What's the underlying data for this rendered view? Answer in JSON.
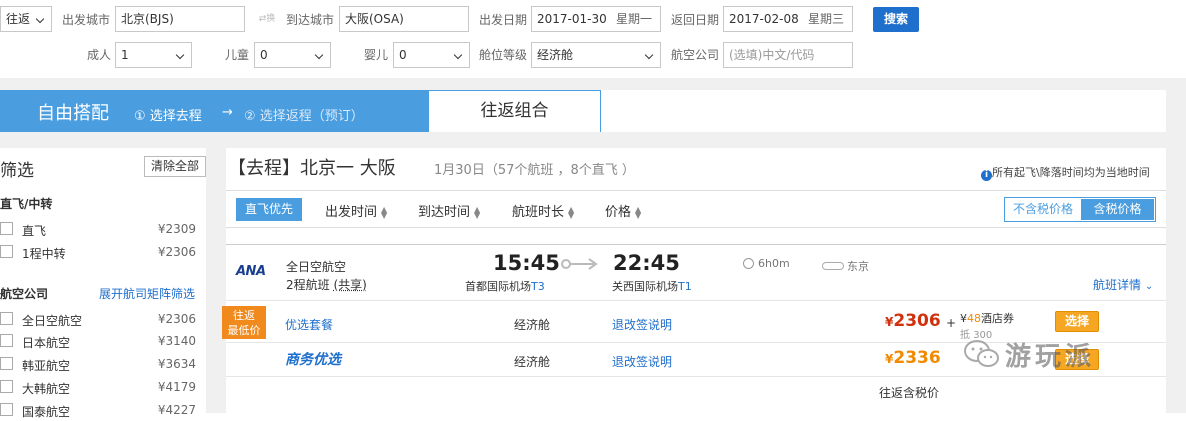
{
  "search": {
    "trip_type": "往返",
    "from_label": "出发城市",
    "from_value": "北京(BJS)",
    "swap_label": "换",
    "to_label": "到达城市",
    "to_value": "大阪(OSA)",
    "depart_label": "出发日期",
    "depart_date": "2017-01-30",
    "depart_weekday": "星期一",
    "return_label": "返回日期",
    "return_date": "2017-02-08",
    "return_weekday": "星期三",
    "search_button": "搜索",
    "adult_label": "成人",
    "adult_value": "1",
    "child_label": "儿童",
    "child_value": "0",
    "infant_label": "婴儿",
    "infant_value": "0",
    "cabin_label": "舱位等级",
    "cabin_value": "经济舱",
    "airline_label": "航空公司",
    "airline_placeholder": "(选填)中文/代码"
  },
  "tabs": {
    "title": "自由搭配",
    "step1": "① 选择去程",
    "arrow": "→",
    "step2": "② 选择返程（预订）",
    "combo": "往返组合"
  },
  "sidebar": {
    "title": "筛选",
    "clear_all": "清除全部",
    "direct_section": "直飞/中转",
    "direct_items": [
      {
        "name": "直飞",
        "price": "¥2309"
      },
      {
        "name": "1程中转",
        "price": "¥2306"
      }
    ],
    "airline_section": "航空公司",
    "airline_matrix_link": "展开航司矩阵筛选",
    "airline_items": [
      {
        "name": "全日空航空",
        "price": "¥2306"
      },
      {
        "name": "日本航空",
        "price": "¥3140"
      },
      {
        "name": "韩亚航空",
        "price": "¥3634"
      },
      {
        "name": "大韩航空",
        "price": "¥4179"
      },
      {
        "name": "国泰航空",
        "price": "¥4227"
      }
    ]
  },
  "results": {
    "leg_tag": "【去程】",
    "route": "北京一 大阪",
    "summary": "1月30日（57个航班 ，8个直飞 ）",
    "time_note": "所有起飞\\降落时间均为当地时间",
    "sort": {
      "direct_first": "直飞优先",
      "depart_time": "出发时间",
      "arrive_time": "到达时间",
      "duration": "航班时长",
      "price": "价格"
    },
    "price_toggle": {
      "excl_tax": "不含税价格",
      "incl_tax": "含税价格"
    },
    "flight": {
      "airline_logo": "ANA",
      "airline_name": "全日空航空",
      "leg_info": "2程航班",
      "codeshare": "(共享)",
      "depart_time": "15:45",
      "depart_airport": "首都国际机场",
      "depart_terminal": "T3",
      "arrive_time": "22:45",
      "arrive_airport": "关西国际机场",
      "arrive_terminal": "T1",
      "duration": "6h0m",
      "stopover": "东京",
      "details_link": "航班详情"
    },
    "fares": [
      {
        "badge_line1": "往返",
        "badge_line2": "最低价",
        "package": "优选套餐",
        "cabin": "经济舱",
        "rules": "退改签说明",
        "currency": "¥",
        "price": "2306",
        "plus": "+",
        "voucher_value": "48",
        "voucher_label": "酒店券",
        "deduct_text": "抵",
        "deduct_value": "300",
        "select": "选择"
      },
      {
        "package": "商务优选",
        "cabin": "经济舱",
        "rules": "退改签说明",
        "currency": "¥",
        "price": "2336",
        "select": "选择"
      }
    ],
    "footer_note": "往返含税价"
  },
  "watermark": "游玩派",
  "colors": {
    "brand_blue": "#4a9ee0",
    "button_blue": "#1f6fcc",
    "price_red": "#e03a10",
    "price_orange": "#f08a00",
    "select_orange": "#f5a623"
  }
}
